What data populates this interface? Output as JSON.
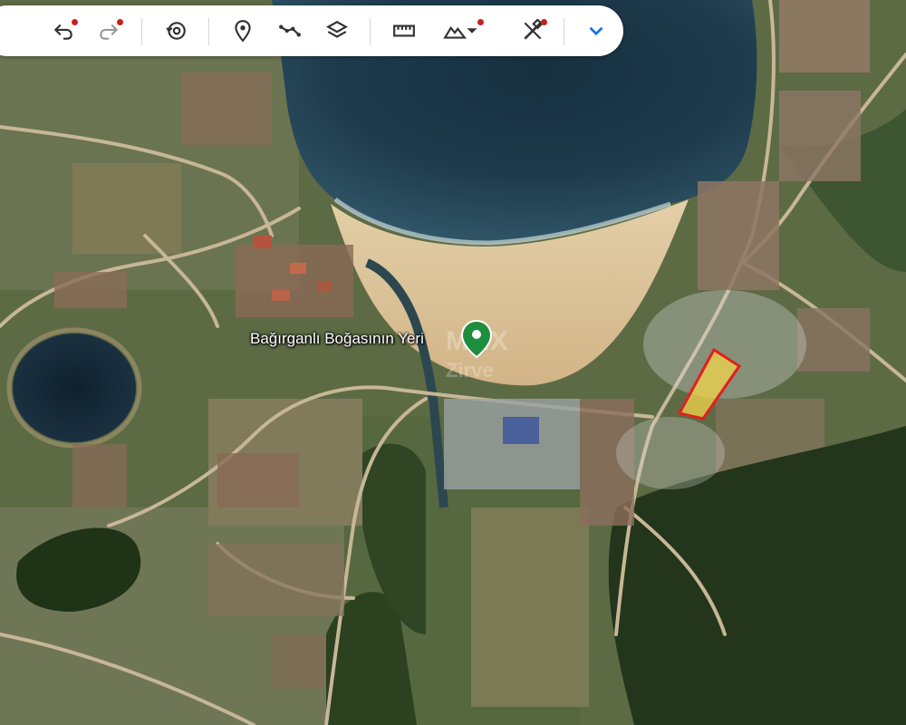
{
  "map": {
    "place_label": "Bağırganlı Boğasının Yeri",
    "watermark_top": "MAX",
    "watermark_bottom": "Zirve",
    "parcel_fill": "#f2d64b",
    "parcel_outline": "#e02020",
    "pin_color": "#1e8e3e",
    "sea_color": "#1e3a4c",
    "lake_color": "#152a3a",
    "beach_color": "#dcc39a"
  },
  "toolbar": {
    "buttons": [
      {
        "name": "undo-button",
        "icon": "undo-icon",
        "badge": true
      },
      {
        "name": "redo-button",
        "icon": "redo-icon",
        "badge": true,
        "disabled": true
      },
      {
        "name": "history-button",
        "icon": "history-icon",
        "badge": false
      },
      {
        "name": "add-placemark-button",
        "icon": "placemark-icon",
        "badge": false
      },
      {
        "name": "add-path-button",
        "icon": "path-icon",
        "badge": false
      },
      {
        "name": "layers-button",
        "icon": "layers-icon",
        "badge": false
      },
      {
        "name": "measure-button",
        "icon": "ruler-icon",
        "badge": false
      },
      {
        "name": "elevation-button",
        "icon": "terrain-icon",
        "badge": true
      },
      {
        "name": "tools-button",
        "icon": "tools-icon",
        "badge": true
      },
      {
        "name": "expand-button",
        "icon": "chevron-down-icon",
        "badge": false
      }
    ],
    "accent": "#1a73e8",
    "badge_color": "#c5221f"
  }
}
